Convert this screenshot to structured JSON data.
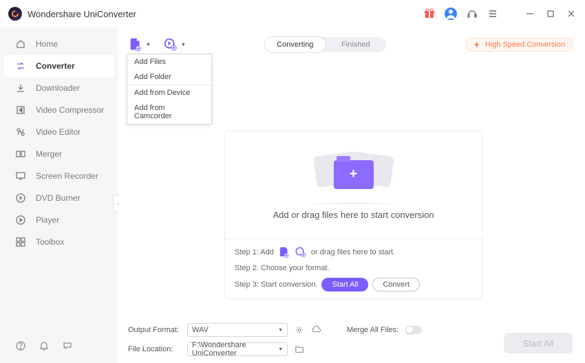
{
  "app": {
    "title": "Wondershare UniConverter"
  },
  "titlebar_icons": [
    "gift-icon",
    "user-icon",
    "headset-icon",
    "menu-icon",
    "minimize-icon",
    "maximize-icon",
    "close-icon"
  ],
  "sidebar": {
    "items": [
      {
        "icon": "home-icon",
        "label": "Home",
        "active": false
      },
      {
        "icon": "converter-icon",
        "label": "Converter",
        "active": true
      },
      {
        "icon": "downloader-icon",
        "label": "Downloader",
        "active": false
      },
      {
        "icon": "compressor-icon",
        "label": "Video Compressor",
        "active": false
      },
      {
        "icon": "editor-icon",
        "label": "Video Editor",
        "active": false
      },
      {
        "icon": "merger-icon",
        "label": "Merger",
        "active": false
      },
      {
        "icon": "recorder-icon",
        "label": "Screen Recorder",
        "active": false
      },
      {
        "icon": "dvd-icon",
        "label": "DVD Burner",
        "active": false
      },
      {
        "icon": "player-icon",
        "label": "Player",
        "active": false
      },
      {
        "icon": "toolbox-icon",
        "label": "Toolbox",
        "active": false
      }
    ]
  },
  "dropdown": {
    "items": [
      {
        "label": "Add Files",
        "sep": false
      },
      {
        "label": "Add Folder",
        "sep": false
      },
      {
        "label": "Add from Device",
        "sep": true
      },
      {
        "label": "Add from Camcorder",
        "sep": false
      }
    ]
  },
  "tabs": {
    "converting": "Converting",
    "finished": "Finished"
  },
  "high_speed": "High Speed Conversion",
  "drop": {
    "text": "Add or drag files here to start conversion"
  },
  "steps": {
    "s1a": "Step 1: Add",
    "s1b": "or drag files here to start.",
    "s2": "Step 2: Choose your format.",
    "s3": "Step 3: Start conversion.",
    "start_all": "Start All",
    "convert": "Convert"
  },
  "bottom": {
    "output_label": "Output Format:",
    "output_value": "WAV",
    "location_label": "File Location:",
    "location_value": "F:\\Wondershare UniConverter",
    "merge_label": "Merge All Files:",
    "start_all": "Start All"
  }
}
